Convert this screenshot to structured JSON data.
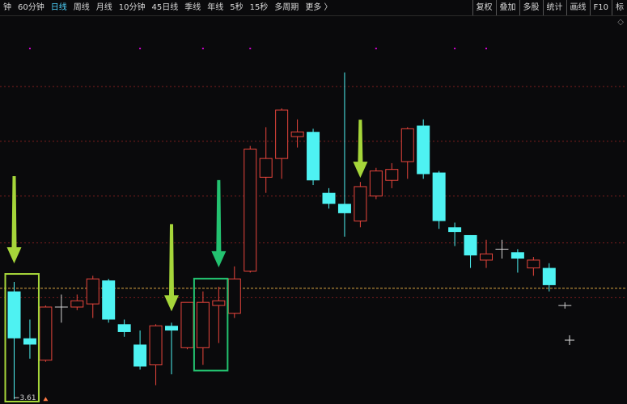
{
  "topbar": {
    "periods": [
      {
        "label": "钟",
        "active": false
      },
      {
        "label": "60分钟",
        "active": false
      },
      {
        "label": "日线",
        "active": true
      },
      {
        "label": "周线",
        "active": false
      },
      {
        "label": "月线",
        "active": false
      },
      {
        "label": "10分钟",
        "active": false
      },
      {
        "label": "45日线",
        "active": false
      },
      {
        "label": "季线",
        "active": false
      },
      {
        "label": "年线",
        "active": false
      },
      {
        "label": "5秒",
        "active": false
      },
      {
        "label": "15秒",
        "active": false
      },
      {
        "label": "多周期",
        "active": false
      },
      {
        "label": "更多 〉",
        "active": false
      }
    ],
    "tools": [
      "复权",
      "叠加",
      "多股",
      "统计",
      "画线",
      "F10",
      "标"
    ]
  },
  "corner_icon": "◇",
  "low_label": "3.61",
  "colors": {
    "up": "#e8453c",
    "down": "#4ef2f2",
    "gridline": "#7a1e1e",
    "price_line": "#d9a441",
    "arrow_light": "#a6d63a",
    "arrow_dark": "#23c270",
    "box_light": "#a6d63a",
    "box_dark": "#23c270",
    "marker": "#d000d0"
  },
  "chart_data": {
    "type": "candlestick",
    "candles": [
      {
        "o": 4.3,
        "c": 4.0,
        "h": 4.36,
        "l": 3.61
      },
      {
        "o": 4.0,
        "c": 3.96,
        "h": 4.12,
        "l": 3.87
      },
      {
        "o": 3.86,
        "c": 4.2,
        "h": 4.21,
        "l": 3.85
      },
      {
        "o": 4.2,
        "c": 4.2,
        "h": 4.28,
        "l": 4.1
      },
      {
        "o": 4.2,
        "c": 4.24,
        "h": 4.28,
        "l": 4.18
      },
      {
        "o": 4.22,
        "c": 4.38,
        "h": 4.4,
        "l": 4.13
      },
      {
        "o": 4.37,
        "c": 4.12,
        "h": 4.38,
        "l": 4.1
      },
      {
        "o": 4.09,
        "c": 4.04,
        "h": 4.12,
        "l": 4.01
      },
      {
        "o": 3.96,
        "c": 3.82,
        "h": 4.05,
        "l": 3.8
      },
      {
        "o": 3.83,
        "c": 4.08,
        "h": 4.09,
        "l": 3.7
      },
      {
        "o": 4.08,
        "c": 4.05,
        "h": 4.1,
        "l": 3.77
      },
      {
        "o": 3.94,
        "c": 4.23,
        "h": 4.23,
        "l": 3.93
      },
      {
        "o": 3.94,
        "c": 4.23,
        "h": 4.3,
        "l": 3.83
      },
      {
        "o": 4.21,
        "c": 4.24,
        "h": 4.33,
        "l": 3.97
      },
      {
        "o": 4.16,
        "c": 4.38,
        "h": 4.46,
        "l": 4.13
      },
      {
        "o": 4.43,
        "c": 5.21,
        "h": 5.23,
        "l": 4.42
      },
      {
        "o": 5.03,
        "c": 5.15,
        "h": 5.35,
        "l": 4.93
      },
      {
        "o": 5.15,
        "c": 5.46,
        "h": 5.47,
        "l": 5.02
      },
      {
        "o": 5.29,
        "c": 5.32,
        "h": 5.4,
        "l": 5.22
      },
      {
        "o": 5.32,
        "c": 5.01,
        "h": 5.34,
        "l": 4.98
      },
      {
        "o": 4.93,
        "c": 4.86,
        "h": 4.96,
        "l": 4.83
      },
      {
        "o": 4.86,
        "c": 4.8,
        "h": 5.7,
        "l": 4.65
      },
      {
        "o": 4.75,
        "c": 4.97,
        "h": 5.0,
        "l": 4.71
      },
      {
        "o": 4.91,
        "c": 5.07,
        "h": 5.09,
        "l": 4.89
      },
      {
        "o": 5.01,
        "c": 5.08,
        "h": 5.12,
        "l": 4.96
      },
      {
        "o": 5.13,
        "c": 5.34,
        "h": 5.35,
        "l": 5.02
      },
      {
        "o": 5.36,
        "c": 5.05,
        "h": 5.4,
        "l": 5.02
      },
      {
        "o": 5.06,
        "c": 4.75,
        "h": 5.07,
        "l": 4.7
      },
      {
        "o": 4.71,
        "c": 4.68,
        "h": 4.74,
        "l": 4.59
      },
      {
        "o": 4.66,
        "c": 4.53,
        "h": 4.66,
        "l": 4.45
      },
      {
        "o": 4.5,
        "c": 4.54,
        "h": 4.63,
        "l": 4.45
      },
      {
        "o": 4.57,
        "c": 4.57,
        "h": 4.63,
        "l": 4.51
      },
      {
        "o": 4.55,
        "c": 4.51,
        "h": 4.57,
        "l": 4.42
      },
      {
        "o": 4.45,
        "c": 4.5,
        "h": 4.52,
        "l": 4.4
      },
      {
        "o": 4.45,
        "c": 4.34,
        "h": 4.48,
        "l": 4.3
      },
      {
        "o": 4.21,
        "c": 4.21,
        "h": 4.23,
        "l": 4.19
      }
    ],
    "current_price": 4.32,
    "ylim": [
      3.58,
      6.06
    ],
    "gridlines": [
      4.26,
      4.61,
      4.91,
      5.26,
      5.61
    ],
    "grid": true
  },
  "annotations": {
    "arrows": [
      {
        "candle": 0,
        "color": "light"
      },
      {
        "candle": 10,
        "color": "light"
      },
      {
        "candle": 13,
        "color": "dark"
      },
      {
        "candle": 22,
        "color": "light"
      }
    ],
    "boxes": [
      {
        "from": 0,
        "to": 1,
        "color": "light"
      },
      {
        "from": 12,
        "to": 13,
        "color": "dark"
      }
    ]
  }
}
